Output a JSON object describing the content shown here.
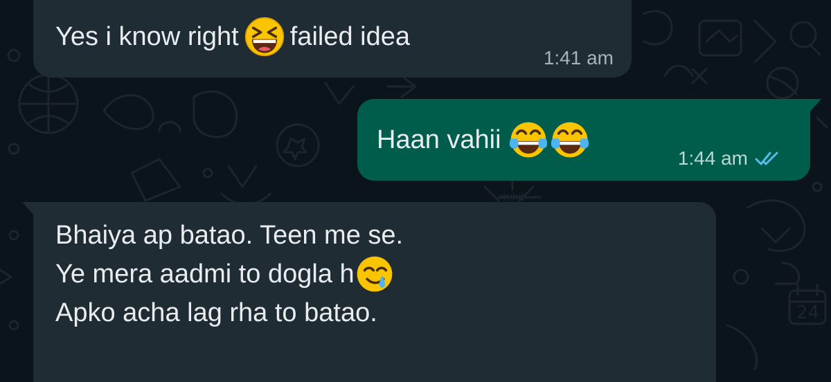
{
  "chat": {
    "messages": [
      {
        "direction": "incoming",
        "text_before": "Yes i know right",
        "emoji": "grinning-squinting-face",
        "text_after": "failed idea",
        "time": "1:41 am"
      },
      {
        "direction": "outgoing",
        "text": "Haan vahii",
        "emoji": "face-with-tears-of-joy",
        "emoji_count": 2,
        "time": "1:44 am",
        "status": "read"
      },
      {
        "direction": "incoming",
        "line1": "Bhaiya ap batao. Teen me se.",
        "line2_text": "Ye mera aadmi to dogla h",
        "line2_emoji": "smiling-face-with-tear",
        "line3": "Apko acha lag rha to batao."
      }
    ]
  },
  "colors": {
    "background": "#0b141a",
    "incoming_bubble": "#202c33",
    "outgoing_bubble": "#005c4b",
    "text": "#e9edef",
    "read_ticks": "#53bdeb"
  }
}
